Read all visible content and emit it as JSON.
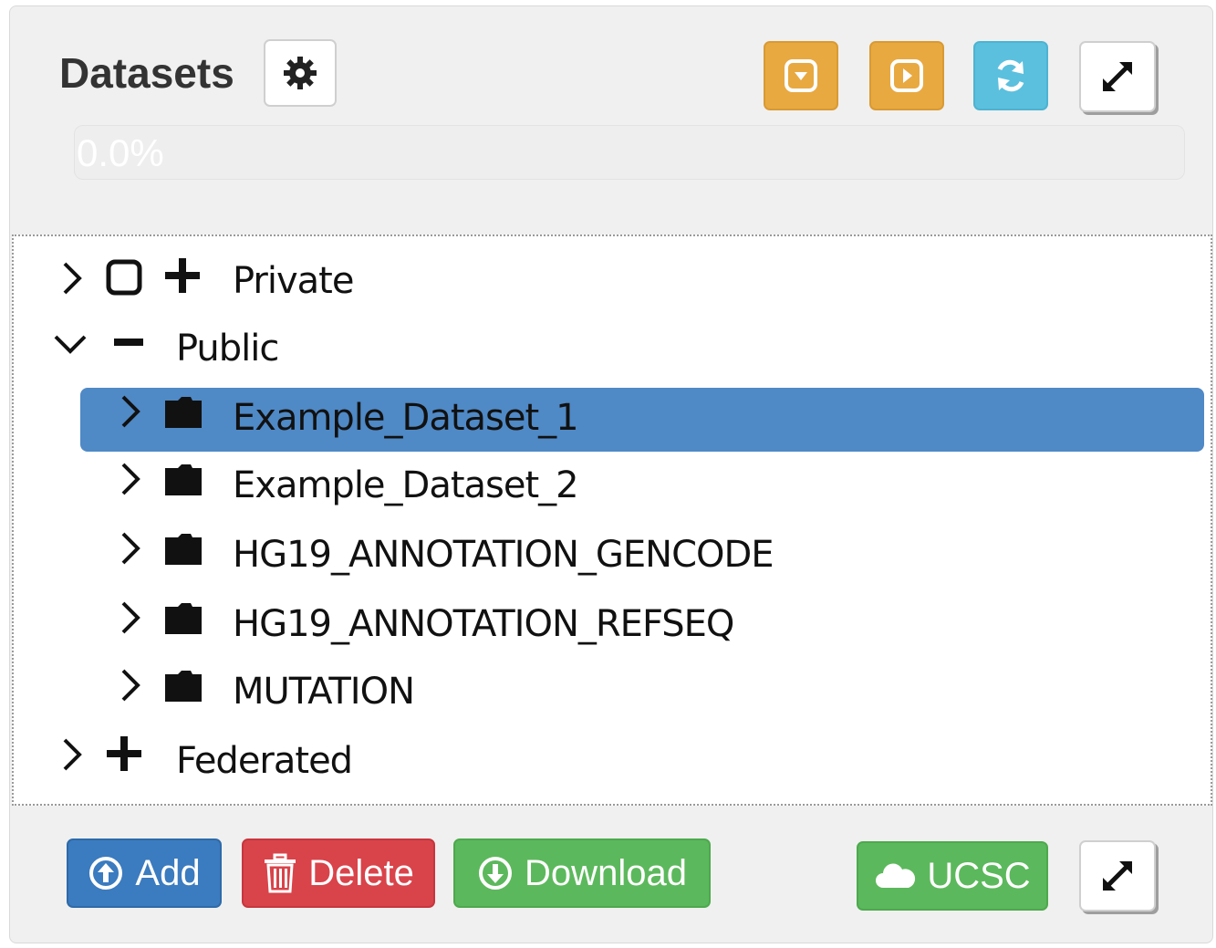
{
  "header": {
    "title": "Datasets",
    "settings_icon": "gear-icon",
    "toolbar": [
      {
        "name": "collapse-all-button",
        "icon": "caret-square-down-icon",
        "color": "#e8a941"
      },
      {
        "name": "expand-all-button",
        "icon": "caret-square-right-icon",
        "color": "#e8a941"
      },
      {
        "name": "refresh-button",
        "icon": "refresh-icon",
        "color": "#5bc0de"
      },
      {
        "name": "maximize-button",
        "icon": "expand-arrows-icon",
        "color": "#ffffff"
      }
    ]
  },
  "progress": {
    "text": "0.0%",
    "value": 0.0
  },
  "tree": {
    "nodes": [
      {
        "label": "Private",
        "expanded": false,
        "level": 0
      },
      {
        "label": "Public",
        "expanded": true,
        "level": 0
      },
      {
        "label": "Example_Dataset_1",
        "level": 1,
        "selected": true
      },
      {
        "label": "Example_Dataset_2",
        "level": 1
      },
      {
        "label": "HG19_ANNOTATION_GENCODE",
        "level": 1
      },
      {
        "label": "HG19_ANNOTATION_REFSEQ",
        "level": 1
      },
      {
        "label": "MUTATION",
        "level": 1
      },
      {
        "label": "Federated",
        "expanded": false,
        "level": 0
      }
    ]
  },
  "footer": {
    "add_label": "Add",
    "delete_label": "Delete",
    "download_label": "Download",
    "ucsc_label": "UCSC"
  },
  "colors": {
    "selected_row": "#4f89c6",
    "primary": "#3b7bbf",
    "danger": "#d9434a",
    "success": "#5cb85c",
    "warning": "#e8a941",
    "info": "#5bc0de"
  }
}
